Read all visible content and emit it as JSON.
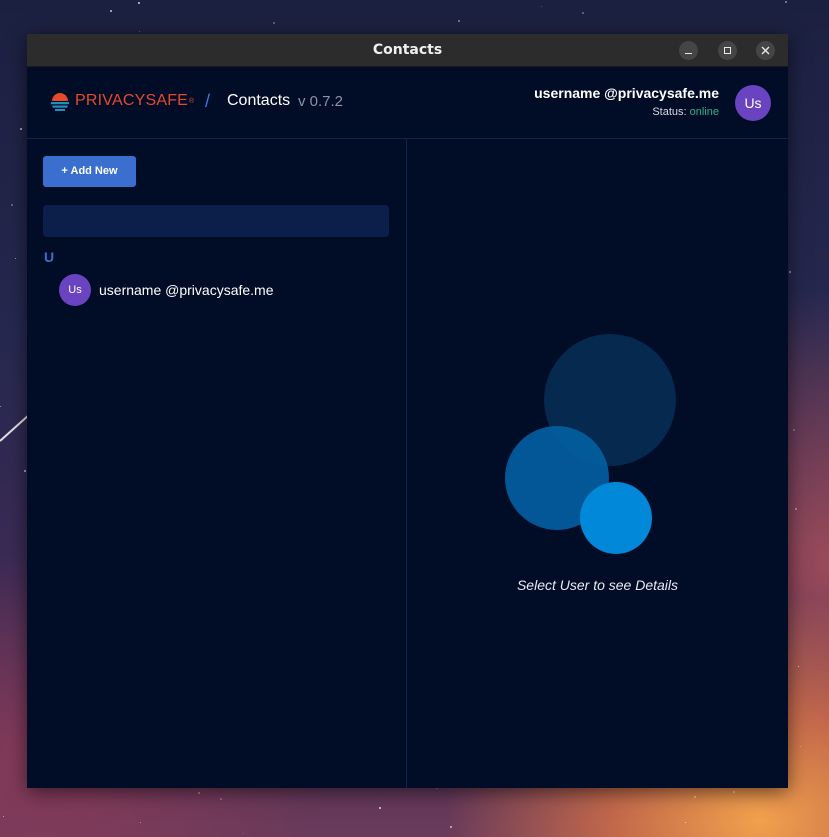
{
  "window": {
    "title": "Contacts",
    "controls": [
      "minimize-icon",
      "maximize-icon",
      "close-icon"
    ]
  },
  "header": {
    "brand": "PRIVACYSAFE",
    "brand_mark": "®",
    "separator": "/",
    "page_title": "Contacts",
    "version": "v 0.7.2",
    "user": {
      "name": "username @privacysafe.me",
      "status_label": "Status:",
      "status_value": "online",
      "initials": "Us"
    }
  },
  "sidebar": {
    "add_button_label": "+ Add New",
    "search": {
      "value": "",
      "placeholder": ""
    },
    "groups": [
      {
        "letter": "U",
        "contacts": [
          {
            "initials": "Us",
            "name": "username @privacysafe.me"
          }
        ]
      }
    ]
  },
  "details": {
    "empty_hint": "Select User to see Details"
  },
  "colors": {
    "app_bg": "#010c26",
    "accent": "#3a6fd0",
    "brand": "#e5492e",
    "avatar": "#6a44c0",
    "status_online": "#33b38a"
  }
}
